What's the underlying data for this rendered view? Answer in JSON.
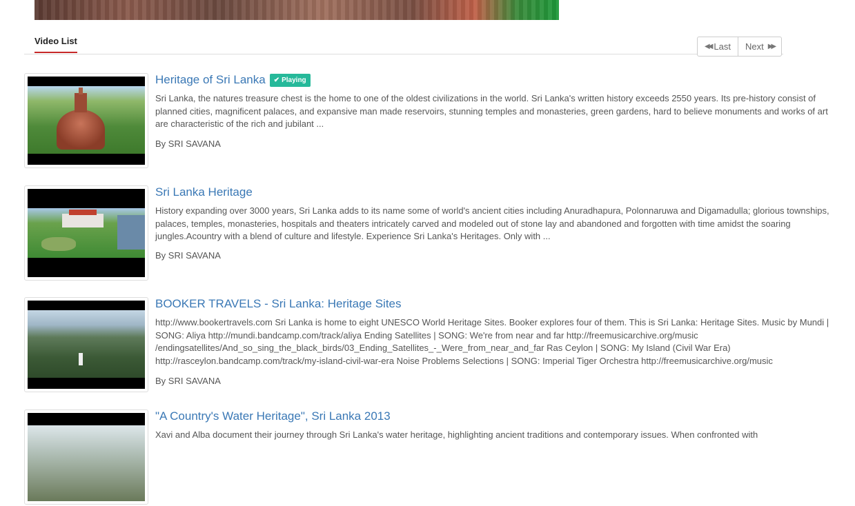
{
  "tabs": {
    "active_label": "Video List"
  },
  "pager": {
    "last_label": "Last",
    "next_label": "Next"
  },
  "videos": [
    {
      "title": "Heritage of Sri Lanka",
      "badge": "Playing",
      "description": "Sri Lanka, the natures treasure chest is the home to one of the oldest civilizations in the world. Sri Lanka's written history exceeds 2550 years. Its pre-history consist of planned cities, magnificent palaces, and expansive man made reservoirs, stunning temples and monasteries, green gardens, hard to believe monuments and works of art are characteristic of the rich and jubilant ...",
      "author": "By SRI SAVANA"
    },
    {
      "title": "Sri Lanka Heritage",
      "description": "History expanding over 3000 years, Sri Lanka adds to its name some of world's ancient cities including Anuradhapura, Polonnaruwa and Digamadulla; glorious townships, palaces, temples, monasteries, hospitals and theaters intricately carved and modeled out of stone lay and abandoned and forgotten with time amidst the soaring jungles.Acountry with a blend of culture and lifestyle. Experience Sri Lanka's Heritages. Only with ...",
      "author": "By SRI SAVANA"
    },
    {
      "title": "BOOKER TRAVELS - Sri Lanka: Heritage Sites",
      "description": "http://www.bookertravels.com Sri Lanka is home to eight UNESCO World Heritage Sites. Booker explores four of them. This is Sri Lanka: Heritage Sites. Music by Mundi | SONG: Aliya http://mundi.bandcamp.com/track/aliya Ending Satellites | SONG: We're from near and far http://freemusicarchive.org/music /endingsatellites/And_so_sing_the_black_birds/03_Ending_Satellites_-_Were_from_near_and_far Ras Ceylon | SONG: My Island (Civil War Era) http://rasceylon.bandcamp.com/track/my-island-civil-war-era Noise Problems Selections | SONG: Imperial Tiger Orchestra http://freemusicarchive.org/music",
      "author": "By SRI SAVANA"
    },
    {
      "title": "\"A Country's Water Heritage\", Sri Lanka 2013",
      "description": "Xavi and Alba document their journey through Sri Lanka's water heritage, highlighting ancient traditions and contemporary issues. When confronted with",
      "author": ""
    }
  ]
}
